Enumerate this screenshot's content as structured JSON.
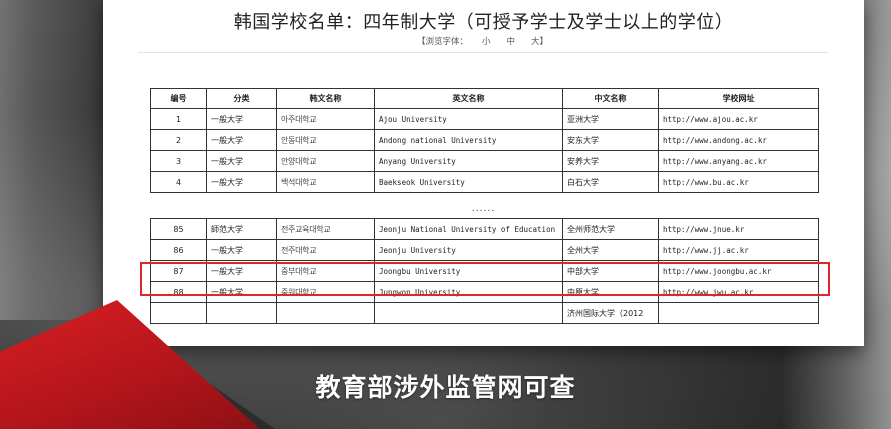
{
  "document": {
    "title": "韩国学校名单：四年制大学（可授予学士及学士以上的学位）",
    "font_size_bar": {
      "prefix": "【浏览字体：",
      "small": "小",
      "medium": "中",
      "large": "大】"
    },
    "table": {
      "headers": [
        "编号",
        "分类",
        "韩文名称",
        "英文名称",
        "中文名称",
        "学校网址"
      ],
      "top_rows": [
        [
          "1",
          "一般大学",
          "아주대학교",
          "Ajou University",
          "亚洲大学",
          "http://www.ajou.ac.kr"
        ],
        [
          "2",
          "一般大学",
          "안동대학교",
          "Andong national University",
          "安东大学",
          "http://www.andong.ac.kr"
        ],
        [
          "3",
          "一般大学",
          "안양대학교",
          "Anyang University",
          "安养大学",
          "http://www.anyang.ac.kr"
        ],
        [
          "4",
          "一般大学",
          "백석대학교",
          "Baekseok University",
          "白石大学",
          "http://www.bu.ac.kr"
        ]
      ],
      "ellipsis": "......",
      "bottom_rows": [
        [
          "85",
          "師范大学",
          "전주교육대학교",
          "Jeonju National University of Education",
          "全州师范大学",
          "http://www.jnue.kr"
        ],
        [
          "86",
          "一般大学",
          "전주대학교",
          "Jeonju University",
          "全州大学",
          "http://www.jj.ac.kr"
        ],
        [
          "87",
          "一般大学",
          "중부대학교",
          "Joongbu University",
          "中部大学",
          "http://www.joongbu.ac.kr"
        ],
        [
          "88",
          "一般大学",
          "중원대학교",
          "Jungwon University",
          "中原大学",
          "http://www.jwu.ac.kr"
        ],
        [
          "",
          "",
          "",
          "",
          "济州国际大学（2012",
          ""
        ]
      ]
    },
    "highlight_color": "#e0262b"
  },
  "caption": "教育部涉外监管网可查",
  "colors": {
    "accent_red": "#d81f24",
    "background": "#333333"
  }
}
